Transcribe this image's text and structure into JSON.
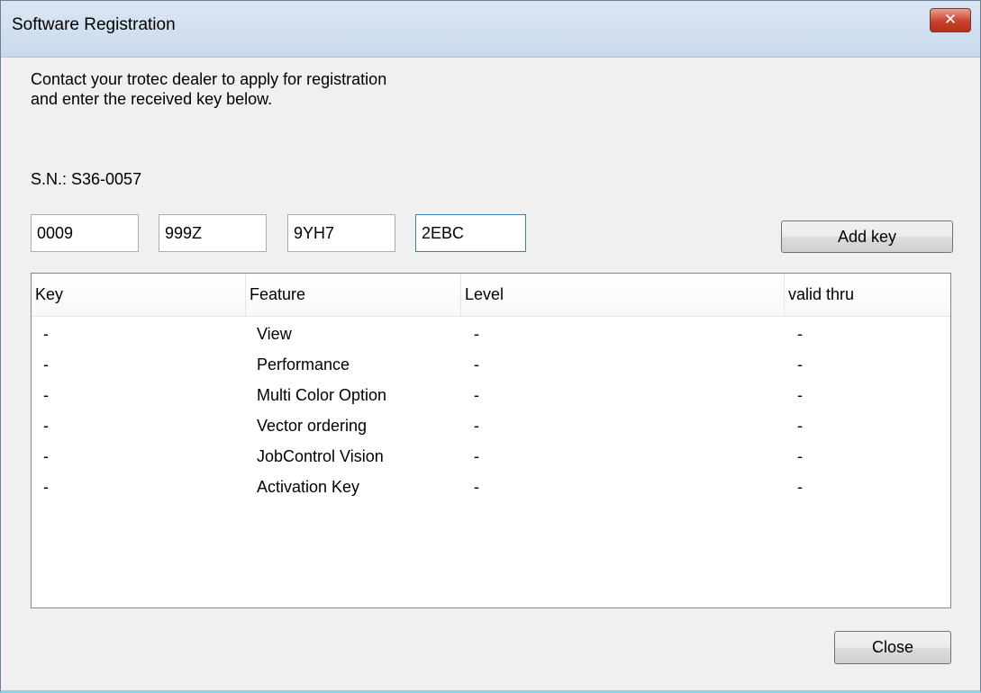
{
  "window": {
    "title": "Software Registration",
    "close_glyph": "✕"
  },
  "instructions": {
    "line1": "Contact your trotec dealer to apply for registration",
    "line2": "and enter the received key below."
  },
  "serial": "S.N.: S36-0057",
  "key_fields": {
    "part1": "0009",
    "part2": "999Z",
    "part3": "9YH7",
    "part4": "2EBC"
  },
  "buttons": {
    "add_key": "Add key",
    "close": "Close"
  },
  "table": {
    "headers": [
      "Key",
      "Feature",
      "Level",
      "valid thru"
    ],
    "rows": [
      {
        "key": "-",
        "feature": "View",
        "level": "-",
        "valid": "-"
      },
      {
        "key": "-",
        "feature": "Performance",
        "level": "-",
        "valid": "-"
      },
      {
        "key": "-",
        "feature": "Multi Color Option",
        "level": "-",
        "valid": "-"
      },
      {
        "key": "-",
        "feature": "Vector ordering",
        "level": "-",
        "valid": "-"
      },
      {
        "key": "-",
        "feature": "JobControl Vision",
        "level": "-",
        "valid": "-"
      },
      {
        "key": "-",
        "feature": "Activation Key",
        "level": "-",
        "valid": "-"
      }
    ]
  },
  "colors": {
    "titlebar": "#c9d9ec",
    "close_button": "#c7412b",
    "dialog_background": "#f0f0f0"
  }
}
